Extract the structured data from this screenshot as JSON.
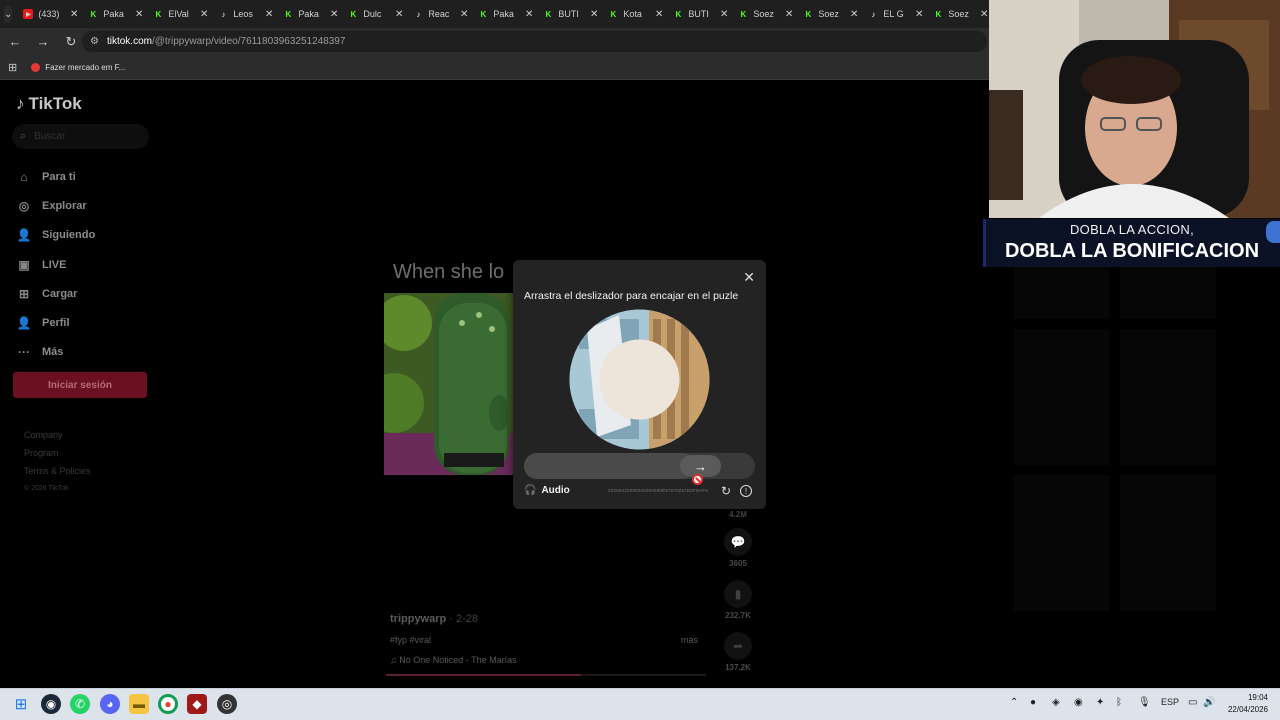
{
  "browser": {
    "tabs": [
      {
        "title": "(433)",
        "favicon": "youtube-icon"
      },
      {
        "title": "Paka",
        "favicon": "kick-icon"
      },
      {
        "title": "ElVal",
        "favicon": "kick-icon"
      },
      {
        "title": "Leos",
        "favicon": "tiktok-icon"
      },
      {
        "title": "Paka",
        "favicon": "kick-icon"
      },
      {
        "title": "Dulc",
        "favicon": "kick-icon"
      },
      {
        "title": "Reac",
        "favicon": "tiktok-icon"
      },
      {
        "title": "Paka",
        "favicon": "kick-icon"
      },
      {
        "title": "BUTI",
        "favicon": "kick-icon"
      },
      {
        "title": "Kota",
        "favicon": "kick-icon"
      },
      {
        "title": "BUTI",
        "favicon": "kick-icon"
      },
      {
        "title": "Soez",
        "favicon": "kick-icon"
      },
      {
        "title": "Soez",
        "favicon": "kick-icon"
      },
      {
        "title": "EL G",
        "favicon": "tiktok-icon"
      },
      {
        "title": "Soez",
        "favicon": "kick-icon"
      }
    ],
    "url_host": "tiktok.com",
    "url_path": "/@trippywarp/video/7611803963251248397",
    "bookmark": "Fazer mercado em F..."
  },
  "tiktok": {
    "logo": "TikTok",
    "search_placeholder": "Buscar",
    "nav": [
      {
        "label": "Para ti",
        "icon": "home-icon"
      },
      {
        "label": "Explorar",
        "icon": "compass-icon"
      },
      {
        "label": "Siguiendo",
        "icon": "following-icon"
      },
      {
        "label": "LIVE",
        "icon": "live-icon"
      },
      {
        "label": "Cargar",
        "icon": "upload-icon"
      },
      {
        "label": "Perfil",
        "icon": "profile-icon"
      },
      {
        "label": "Más",
        "icon": "more-icon"
      }
    ],
    "login_button": "Iniciar sesión",
    "footer": {
      "company": "Company",
      "program": "Program",
      "terms": "Terms & Policies",
      "copyright": "© 2026 TikTok"
    },
    "video": {
      "caption_top": "When she lo",
      "author": "trippywarp",
      "date": " · 2-28",
      "description": "#fyp #viral",
      "more": "más",
      "music": "No One Noticed - The Marías",
      "progress": 0.61
    },
    "actions": {
      "likes": "4.2M",
      "comments": "3605",
      "saves": "232.7K",
      "shares": "137.2K"
    }
  },
  "captcha": {
    "title": "Arrastra el deslizador para encajar en el puzle",
    "audio_label": "Audio",
    "id_text": "20260422090044093690E57670257B2FDAF6",
    "slider_progress": 0.74
  },
  "stream_overlay": {
    "line1": "DOBLA LA ACCION,",
    "line2": "DOBLA LA BONIFICACION"
  },
  "taskbar": {
    "lang": "ESP",
    "time": "19:04",
    "date": "22/04/2026"
  }
}
